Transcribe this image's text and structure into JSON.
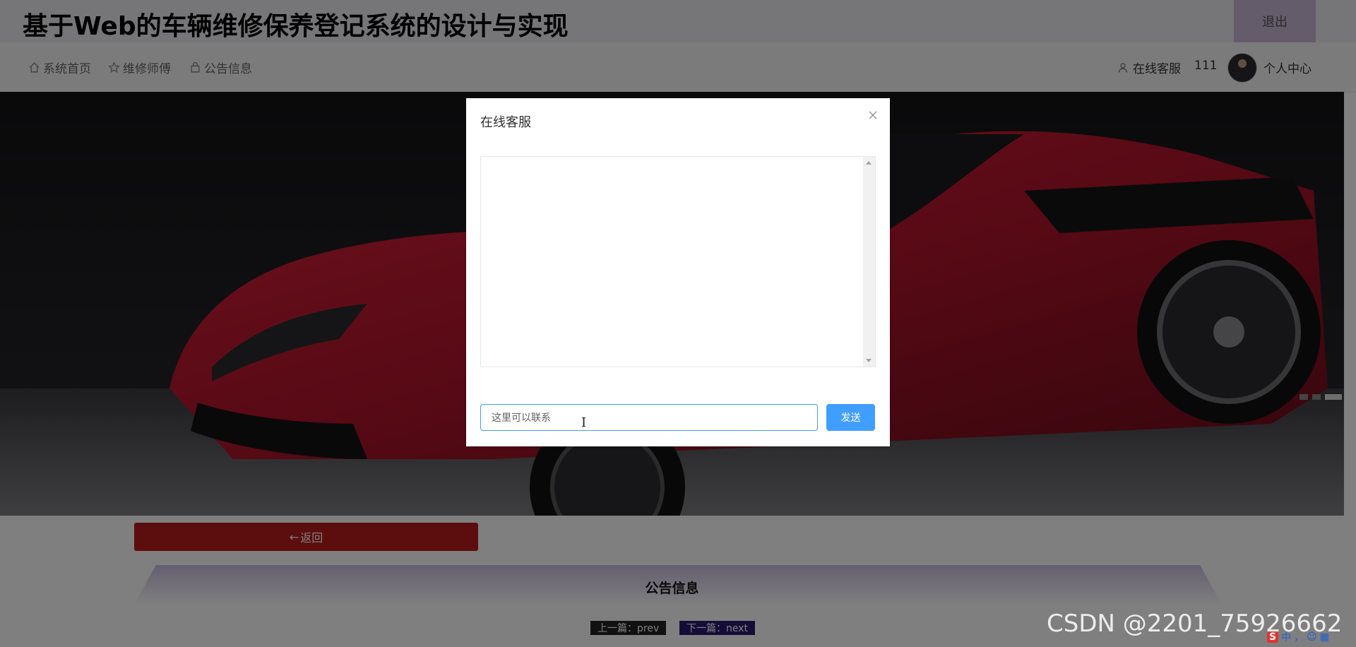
{
  "header": {
    "site_title": "基于Web的车辆维修保养登记系统的设计与实现",
    "logout_label": "退出"
  },
  "nav": {
    "items": [
      {
        "label": "系统首页",
        "icon": "home-icon"
      },
      {
        "label": "维修师傅",
        "icon": "star-icon"
      },
      {
        "label": "公告信息",
        "icon": "bag-icon"
      }
    ],
    "right": {
      "service_label": "在线客服",
      "username": "111",
      "profile_label": "个人中心"
    }
  },
  "page": {
    "back_label": "返回",
    "section_title": "公告信息",
    "prev_label": "上一篇：prev",
    "next_label": "下一篇：next"
  },
  "dialog": {
    "title": "在线客服",
    "input_value": "这里可以联系",
    "send_label": "发送"
  },
  "watermark": "CSDN @2201_75926662",
  "ime": {
    "lang": "中",
    "punct": "，"
  },
  "colors": {
    "primary": "#409eff",
    "back_button": "#b81c1c",
    "logout_bg": "#c9b7d6"
  }
}
